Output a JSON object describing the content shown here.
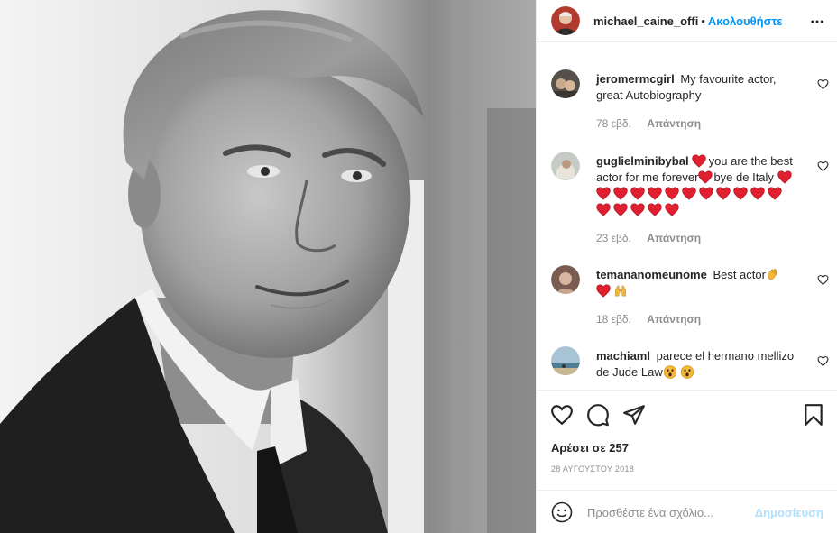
{
  "post": {
    "author": "michael_caine_offi",
    "separator": "•",
    "follow_label": "Ακολουθήστε",
    "likes_text": "Αρέσει σε 257",
    "date_text": "28 ΑΥΓΟΥΣΤΟΥ 2018"
  },
  "comments": [
    {
      "user": "jeromermcgirl",
      "text": "My favourite actor, great Autobiography",
      "age": "78 εβδ.",
      "reply_label": "Απάντηση"
    },
    {
      "user": "guglielminibybal",
      "text_a": "you are the best actor for me forever",
      "text_b": "bye de Italy",
      "age": "23 εβδ.",
      "reply_label": "Απάντηση"
    },
    {
      "user": "temananomeunome",
      "text": "Best actor",
      "age": "18 εβδ.",
      "reply_label": "Απάντηση"
    },
    {
      "user": "machiaml",
      "text": "parece el hermano mellizo de Jude Law"
    }
  ],
  "composer": {
    "placeholder": "Προσθέστε ένα σχόλιο...",
    "publish_label": "Δημοσίευση"
  },
  "icons": {
    "more": "more-options-icon",
    "like": "heart-icon",
    "comment": "comment-bubble-icon",
    "share": "paper-plane-icon",
    "save": "bookmark-icon",
    "emoji": "smiley-icon",
    "emoji_heart": "red-heart-emoji",
    "emoji_clap": "clapping-hands-emoji",
    "emoji_raised": "raised-hands-emoji",
    "emoji_surprised": "surprised-face-emoji"
  },
  "colors": {
    "link_blue": "#0095f6",
    "publish_disabled": "#b2dffc",
    "meta_grey": "#8e8e8e",
    "heart_red": "#ed4956"
  }
}
